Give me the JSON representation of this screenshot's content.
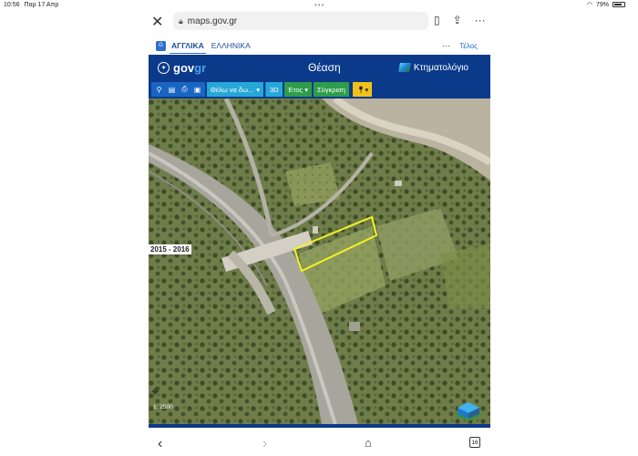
{
  "status": {
    "time": "10:56",
    "date": "Παρ 17 Απρ",
    "battery": "79%",
    "battery_level": 0.79
  },
  "browser": {
    "url": "maps.gov.gr",
    "icons": [
      "close-icon",
      "lock-icon",
      "bookmark-icon",
      "share-icon",
      "more-icon"
    ]
  },
  "lang": {
    "english": "ΑΓΓΛΙΚΑ",
    "greek": "ΕΛΛΗΝΙΚΑ",
    "more": "···",
    "done": "Τέλος"
  },
  "header": {
    "logo_gov": "gov",
    "logo_gr": "gr",
    "title": "Θέαση",
    "brand": "Κτηματολόγιο"
  },
  "toolbar": {
    "dropdown": "Θέλω να δω...",
    "three_d": "3D",
    "year": "Έτος",
    "compare": "Σύγκριση"
  },
  "map": {
    "year": "2015 - 2016",
    "scale": "1: 2500"
  },
  "colors": {
    "header_bg": "#0c3a8a",
    "gov_accent": "#4ca3ea",
    "toolbar_cyan": "#27a7d8",
    "toolbar_green": "#2e9d4b",
    "toolbar_yellow": "#f2c21a",
    "parcel_outline": "#f5f222"
  },
  "nav": {
    "tab_count": "16"
  }
}
